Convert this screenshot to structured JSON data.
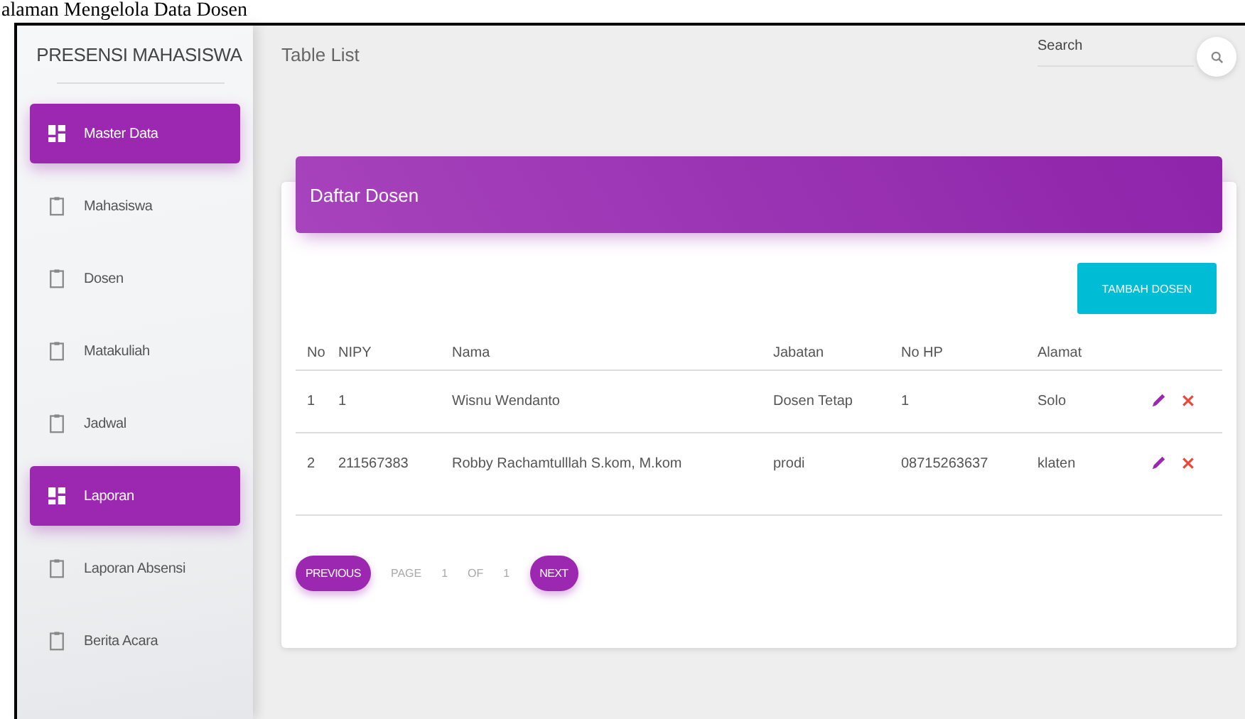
{
  "caption": "alaman Mengelola Data Dosen",
  "sidebar": {
    "title": "PRESENSI MAHASISWA",
    "items": [
      {
        "label": "Master Data",
        "kind": "section"
      },
      {
        "label": "Mahasiswa",
        "kind": "link"
      },
      {
        "label": "Dosen",
        "kind": "link"
      },
      {
        "label": "Matakuliah",
        "kind": "link"
      },
      {
        "label": "Jadwal",
        "kind": "link"
      },
      {
        "label": "Laporan",
        "kind": "section"
      },
      {
        "label": "Laporan Absensi",
        "kind": "link"
      },
      {
        "label": "Berita Acara",
        "kind": "link"
      }
    ]
  },
  "topbar": {
    "title": "Table List",
    "search": {
      "placeholder": "Search"
    }
  },
  "card": {
    "title": "Daftar Dosen",
    "add_button": "TAMBAH DOSEN",
    "table": {
      "columns": [
        "No",
        "NIPY",
        "Nama",
        "Jabatan",
        "No HP",
        "Alamat"
      ],
      "rows": [
        [
          "1",
          "1",
          "Wisnu Wendanto",
          "Dosen Tetap",
          "1",
          "Solo"
        ],
        [
          "2",
          "211567383",
          "Robby Rachamtulllah S.kom, M.kom",
          "prodi",
          "08715263637",
          "klaten"
        ]
      ]
    },
    "pagination": {
      "previous": "PREVIOUS",
      "page_label": "PAGE",
      "page": "1",
      "of_label": "OF",
      "total": "1",
      "next": "NEXT"
    }
  }
}
